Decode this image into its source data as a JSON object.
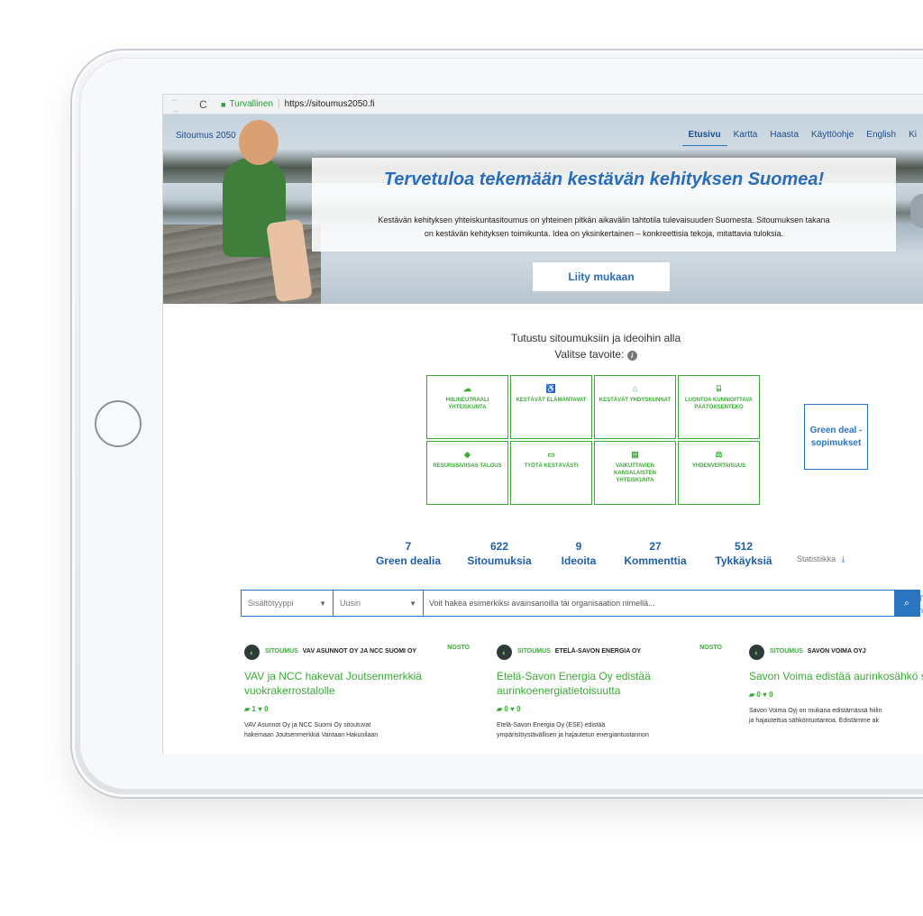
{
  "browser": {
    "nav_arrows": "← →",
    "reload_icon": "C",
    "secure_label": "Turvallinen",
    "url": "https://sitoumus2050.fi"
  },
  "site": {
    "logo": "Sitoumus 2050",
    "nav": [
      "Etusivu",
      "Kartta",
      "Haasta",
      "Käyttöohje",
      "English",
      "Ki"
    ],
    "active_nav": "Etusivu"
  },
  "hero": {
    "title": "Tervetuloa tekemään kestävän kehityksen Suomea!",
    "text_line1": "Kestävän kehityksen yhteiskuntasitoumus on yhteinen pitkän aikavälin tahtotila tulevaisuuden Suomesta. Sitoumuksen takana",
    "text_line2": "on kestävän kehityksen toimikunta. Idea on yksinkertainen – konkreettisia tekoja, mitattavia tuloksia.",
    "cta": "Liity mukaan"
  },
  "goals_section": {
    "intro": "Tutustu sitoumuksiin ja ideoihin alla",
    "choose": "Valitse tavoite:",
    "info_icon": "i",
    "goals": [
      {
        "icon": "☁",
        "label": "HIILINEUTRAALI YHTEISKUNTA"
      },
      {
        "icon": "♿",
        "label": "KESTÄVÄT ELÄMÄNTAVAT"
      },
      {
        "icon": "⌂",
        "label": "KESTÄVÄT YHDYSKUNNAT"
      },
      {
        "icon": "⌸",
        "label": "LUONTOA KUNNIOITTAVA PÄÄTÖKSENTEKO"
      },
      {
        "icon": "◆",
        "label": "RESURSSIVIISAS TALOUS"
      },
      {
        "icon": "▭",
        "label": "TYÖTÄ KESTÄVÄSTI"
      },
      {
        "icon": "▤",
        "label": "VAIKUTTAVIEN KANSALAISTEN YHTEISKUNTA"
      },
      {
        "icon": "⚖",
        "label": "YHDENVERTAISUUS"
      }
    ],
    "green_deal": "Green deal -sopimukset"
  },
  "stats": [
    {
      "number": "7",
      "label": "Green dealia"
    },
    {
      "number": "622",
      "label": "Sitoumuksia"
    },
    {
      "number": "9",
      "label": "Ideoita"
    },
    {
      "number": "27",
      "label": "Kommenttia"
    },
    {
      "number": "512",
      "label": "Tykkäyksiä"
    }
  ],
  "statistics_link": "Statistiikka",
  "search": {
    "type_select": "Sisältötyyppi",
    "sort_select": "Uusin",
    "placeholder": "Voit hakea esimerkiksi avainsanoilla tai organisaation nimellä...",
    "search_icon": "⌕",
    "cut_text_1": "T",
    "cut_text_2": "h"
  },
  "cards": [
    {
      "kind": "SITOUMUS",
      "org": "VAV ASUNNOT OY JA NCC SUOMI OY",
      "badge": "NOSTO",
      "title": "VAV ja NCC hakevat Joutsenmerkkiä vuokrakerrostalolle",
      "comments": "1",
      "likes": "0",
      "desc_line1": "VAV Asunnot Oy ja NCC Suomi Oy sitoutuvat",
      "desc_line2": "hakemaan Joutsenmerkkiä Vantaan Hakunilaan"
    },
    {
      "kind": "SITOUMUS",
      "org": "ETELÄ-SAVON ENERGIA OY",
      "badge": "NOSTO",
      "title": "Etelä-Savon Energia Oy edistää aurinkoenergiatietoisuutta",
      "comments": "0",
      "likes": "0",
      "desc_line1": "Etelä-Savon Energia Oy (ESE) edistää",
      "desc_line2": "ympäristöystävällisen ja hajautetun energiantuotannon"
    },
    {
      "kind": "SITOUMUS",
      "org": "SAVON VOIMA OYJ",
      "badge": "",
      "title": "Savon Voima edistää aurinkosähkö sähköistä liikennettä",
      "comments": "0",
      "likes": "0",
      "desc_line1": "Savon Voima Oyj on mukana edistämässä hiilin",
      "desc_line2": "ja hajautettua sähköntuotantoa. Edistämme ak"
    }
  ],
  "colors": {
    "brand_blue": "#2b74c0",
    "title_blue": "#2a6db8",
    "goal_green": "#3aaa35"
  }
}
